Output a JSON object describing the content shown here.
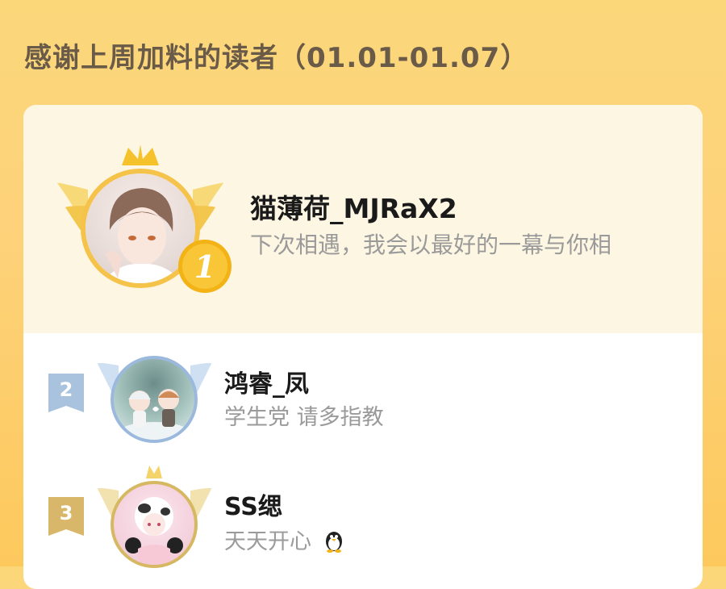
{
  "header": {
    "title": "感谢上周加料的读者（01.01-01.07）"
  },
  "ranking": [
    {
      "rank": "1",
      "name": "猫薄荷_MJRaX2",
      "signature": "下次相遇，我会以最好的一幕与你相",
      "avatar": "anime-boy-avatar-icon"
    },
    {
      "rank": "2",
      "name": "鸿睿_凤",
      "signature": "学生党 请多指教",
      "avatar": "chibi-couple-avatar-icon"
    },
    {
      "rank": "3",
      "name": "SS缌",
      "signature": "天天开心",
      "signature_icon": "penguin-icon",
      "avatar": "cow-girl-avatar-icon"
    }
  ],
  "colors": {
    "background": "#fdd27a",
    "gold": "#f3b316",
    "silver": "#a9c3df",
    "bronze": "#d9b76a",
    "text_title": "#6a5a48"
  }
}
